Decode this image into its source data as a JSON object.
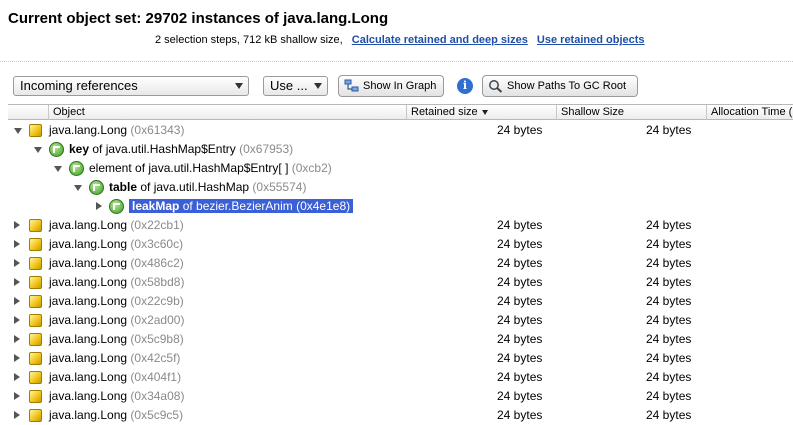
{
  "header": {
    "title": "Current object set:  29702 instances of java.lang.Long",
    "summary": "2 selection steps, 712 kB shallow size,",
    "link_retained": "Calculate retained and deep sizes",
    "link_use_retained": "Use retained objects"
  },
  "toolbar": {
    "view_select": "Incoming references",
    "use_select": "Use ...",
    "show_graph_label": "Show In Graph",
    "info_label": "i",
    "show_paths_label": "Show Paths To GC Root"
  },
  "table": {
    "columns": [
      "Object",
      "Retained size",
      "Shallow Size",
      "Allocation Time ("
    ],
    "sorted_column": "Retained size",
    "rows": [
      {
        "kind": "cube",
        "indent": 0,
        "expander": "down",
        "name": "java.lang.Long",
        "addr": "(0x61343)",
        "retained": "24 bytes",
        "shallow": "24 bytes"
      },
      {
        "kind": "ref",
        "indent": 1,
        "expander": "down",
        "kw": "key",
        "name": " of java.util.HashMap$Entry",
        "addr": "(0x67953)",
        "retained": "",
        "shallow": ""
      },
      {
        "kind": "ref",
        "indent": 2,
        "expander": "down",
        "kw": "",
        "name": "element of java.util.HashMap$Entry[ ]",
        "addr": "(0xcb2)",
        "retained": "",
        "shallow": ""
      },
      {
        "kind": "ref",
        "indent": 3,
        "expander": "down",
        "kw": "table",
        "name": " of java.util.HashMap",
        "addr": "(0x55574)",
        "retained": "",
        "shallow": ""
      },
      {
        "kind": "ref",
        "indent": 4,
        "expander": "right",
        "kw": "leakMap",
        "name": " of bezier.BezierAnim",
        "addr": "(0x4e1e8)",
        "retained": "",
        "shallow": "",
        "selected": true
      },
      {
        "kind": "cube",
        "indent": 0,
        "expander": "right",
        "name": "java.lang.Long",
        "addr": "(0x22cb1)",
        "retained": "24 bytes",
        "shallow": "24 bytes"
      },
      {
        "kind": "cube",
        "indent": 0,
        "expander": "right",
        "name": "java.lang.Long",
        "addr": "(0x3c60c)",
        "retained": "24 bytes",
        "shallow": "24 bytes"
      },
      {
        "kind": "cube",
        "indent": 0,
        "expander": "right",
        "name": "java.lang.Long",
        "addr": "(0x486c2)",
        "retained": "24 bytes",
        "shallow": "24 bytes"
      },
      {
        "kind": "cube",
        "indent": 0,
        "expander": "right",
        "name": "java.lang.Long",
        "addr": "(0x58bd8)",
        "retained": "24 bytes",
        "shallow": "24 bytes"
      },
      {
        "kind": "cube",
        "indent": 0,
        "expander": "right",
        "name": "java.lang.Long",
        "addr": "(0x22c9b)",
        "retained": "24 bytes",
        "shallow": "24 bytes"
      },
      {
        "kind": "cube",
        "indent": 0,
        "expander": "right",
        "name": "java.lang.Long",
        "addr": "(0x2ad00)",
        "retained": "24 bytes",
        "shallow": "24 bytes"
      },
      {
        "kind": "cube",
        "indent": 0,
        "expander": "right",
        "name": "java.lang.Long",
        "addr": "(0x5c9b8)",
        "retained": "24 bytes",
        "shallow": "24 bytes"
      },
      {
        "kind": "cube",
        "indent": 0,
        "expander": "right",
        "name": "java.lang.Long",
        "addr": "(0x42c5f)",
        "retained": "24 bytes",
        "shallow": "24 bytes"
      },
      {
        "kind": "cube",
        "indent": 0,
        "expander": "right",
        "name": "java.lang.Long",
        "addr": "(0x404f1)",
        "retained": "24 bytes",
        "shallow": "24 bytes"
      },
      {
        "kind": "cube",
        "indent": 0,
        "expander": "right",
        "name": "java.lang.Long",
        "addr": "(0x34a08)",
        "retained": "24 bytes",
        "shallow": "24 bytes"
      },
      {
        "kind": "cube",
        "indent": 0,
        "expander": "right",
        "name": "java.lang.Long",
        "addr": "(0x5c9c5)",
        "retained": "24 bytes",
        "shallow": "24 bytes"
      }
    ]
  },
  "colors": {
    "selection": "#3b5fd6",
    "link": "#1f4fa8",
    "address": "#8a8a8a"
  }
}
